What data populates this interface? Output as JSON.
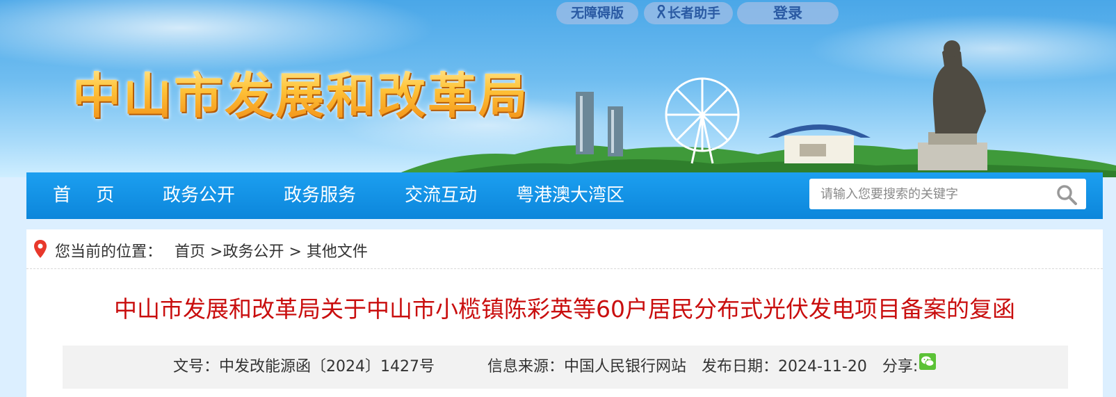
{
  "header": {
    "site_title": "中山市发展和改革局",
    "accessibility_label": "无障碍版",
    "elder_label": "长者助手",
    "login_label": "登录"
  },
  "nav": {
    "items": [
      {
        "label": "首 页"
      },
      {
        "label": "政务公开"
      },
      {
        "label": "政务服务"
      },
      {
        "label": "交流互动"
      },
      {
        "label": "粤港澳大湾区"
      }
    ],
    "search_placeholder": "请输入您要搜索的关键字"
  },
  "breadcrumb": {
    "prefix": "您当前的位置：",
    "items": [
      "首页",
      ">政务公开",
      "> 其他文件"
    ]
  },
  "article": {
    "title": "中山市发展和改革局关于中山市小榄镇陈彩英等60户居民分布式光伏发电项目备案的复函",
    "doc_number": "文号：中发改能源函〔2024〕1427号",
    "source": "信息来源：中国人民银行网站",
    "publish_date": "发布日期：2024-11-20",
    "share_label": "分享:"
  },
  "icons": {
    "location": "location-pin-icon",
    "search": "search-icon",
    "wechat": "wechat-icon",
    "elder": "elder-person-icon"
  },
  "colors": {
    "nav_blue": "#0f8fe3",
    "title_red": "#c90e0e",
    "site_title_orange": "#f5961e",
    "pin_red": "#e8382b",
    "wechat_green": "#5bc236"
  }
}
